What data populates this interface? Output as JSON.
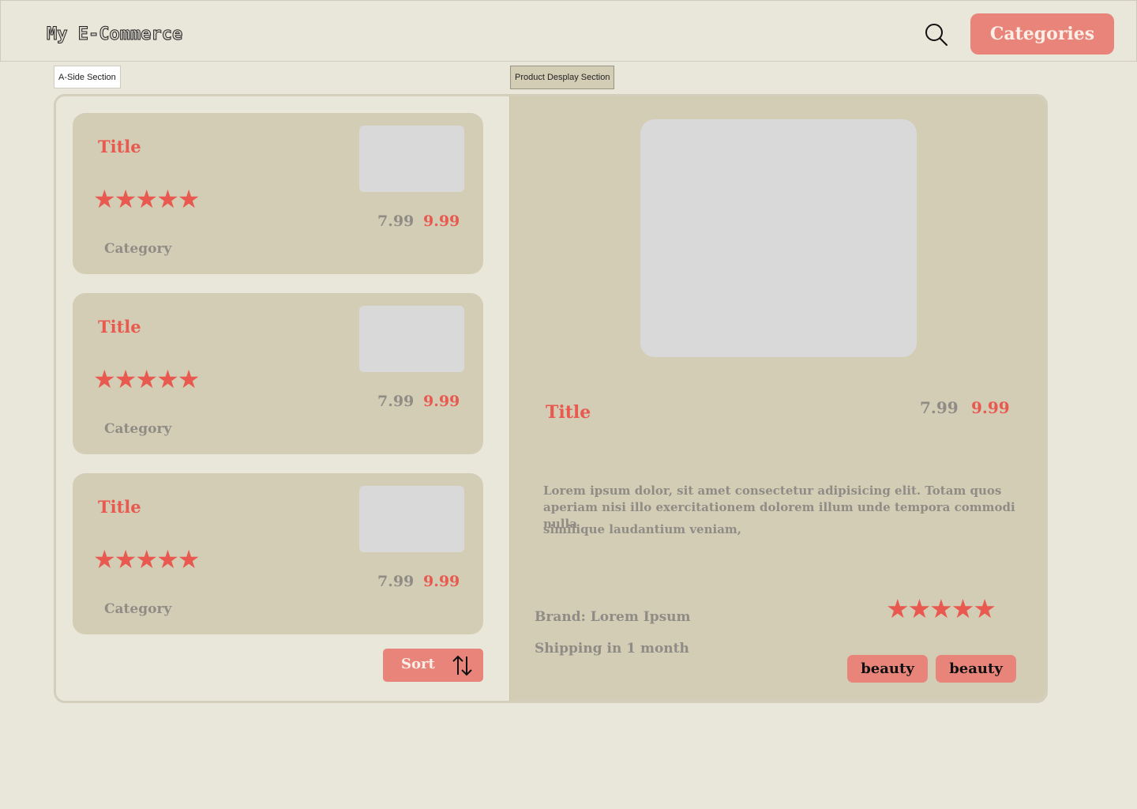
{
  "header": {
    "logo": "My E-Commerce",
    "search_icon": "search-icon",
    "categories_label": "Categories"
  },
  "section_tags": {
    "aside": "A-Side Section",
    "product": "Product Desplay Section"
  },
  "cards": [
    {
      "title": "Title",
      "stars": "★★★★★",
      "rating": 5,
      "old_price": "7.99",
      "new_price": "9.99",
      "category": "Category"
    },
    {
      "title": "Title",
      "stars": "★★★★★",
      "rating": 5,
      "old_price": "7.99",
      "new_price": "9.99",
      "category": "Category"
    },
    {
      "title": "Title",
      "stars": "★★★★★",
      "rating": 5,
      "old_price": "7.99",
      "new_price": "9.99",
      "category": "Category"
    }
  ],
  "sort": {
    "label": "Sort",
    "icon": "sort-arrows-icon"
  },
  "product": {
    "title": "Title",
    "old_price": "7.99",
    "new_price": "9.99",
    "description": "Lorem ipsum dolor, sit amet consectetur adipisicing elit. Totam quos aperiam nisi illo exercitationem dolorem illum unde tempora commodi nulla",
    "description_line2": "similique laudantium veniam,",
    "brand": "Brand: Lorem Ipsum",
    "shipping": "Shipping in 1 month",
    "stars": "★★★★★",
    "rating": 5,
    "tags": [
      "beauty",
      "beauty"
    ]
  },
  "colors": {
    "background": "#e9e6da",
    "panel": "#d4cdb6",
    "accent": "#e8847a",
    "accent_text": "#e8594f",
    "muted": "#8f8c86"
  }
}
